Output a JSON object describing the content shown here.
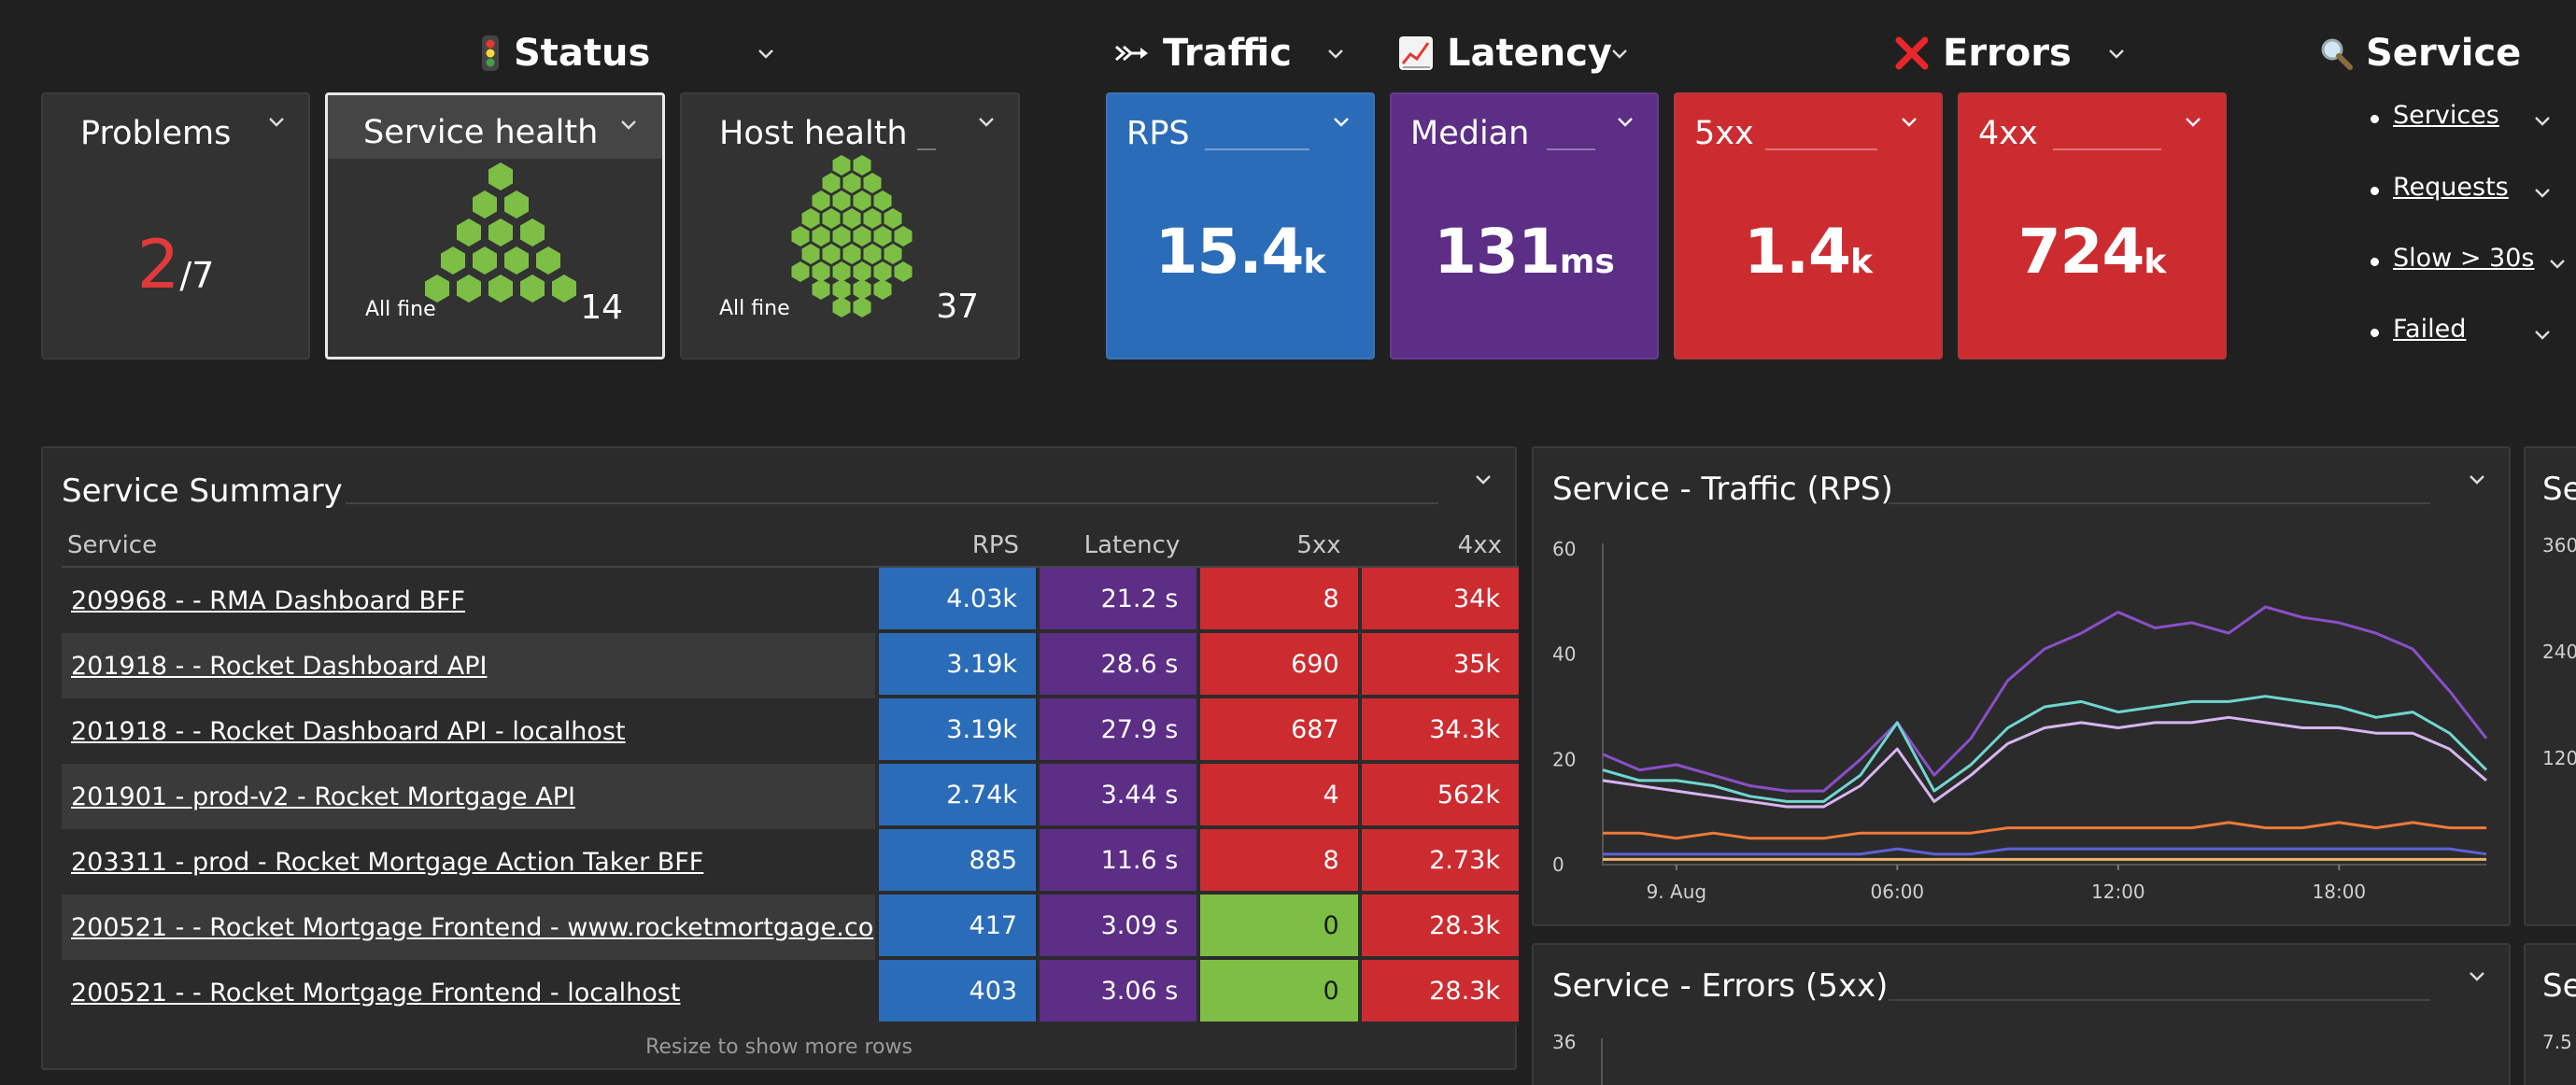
{
  "sections": {
    "status": {
      "label": "Status",
      "icon": "traffic-light-icon"
    },
    "traffic": {
      "label": "Traffic",
      "icon": "arrow-icon"
    },
    "latency": {
      "label": "Latency",
      "icon": "chart-icon"
    },
    "errors": {
      "label": "Errors",
      "icon": "cross-icon"
    },
    "service": {
      "label": "Service",
      "icon": "magnifier-icon"
    }
  },
  "tiles": {
    "problems": {
      "title": "Problems",
      "value": "2",
      "total": "/7"
    },
    "service_health": {
      "title": "Service health",
      "status": "All fine",
      "count": "14",
      "hex_color": "#7dbf44"
    },
    "host_health": {
      "title": "Host health",
      "status": "All fine",
      "count": "37",
      "hex_color": "#7dbf44"
    },
    "rps": {
      "title": "RPS",
      "value": "15.4",
      "unit": "k",
      "color": "#2b6cb8"
    },
    "median": {
      "title": "Median",
      "value": "131",
      "unit": "ms",
      "color": "#5c2e86"
    },
    "err5xx": {
      "title": "5xx",
      "value": "1.4",
      "unit": "k",
      "color": "#cc2c30"
    },
    "err4xx": {
      "title": "4xx",
      "value": "724",
      "unit": "k",
      "color": "#cc2c30"
    }
  },
  "service_links": [
    "Services",
    "Requests",
    "Slow > 30s",
    "Failed"
  ],
  "summary": {
    "title": "Service Summary",
    "columns": [
      "Service",
      "RPS",
      "Latency",
      "5xx",
      "4xx"
    ],
    "rows": [
      {
        "service": "209968 - - RMA Dashboard BFF",
        "rps": "4.03k",
        "latency": "21.2 s",
        "e5xx": "8",
        "e4xx": "34k"
      },
      {
        "service": "201918 - - Rocket Dashboard API",
        "rps": "3.19k",
        "latency": "28.6 s",
        "e5xx": "690",
        "e4xx": "35k"
      },
      {
        "service": "201918 - - Rocket Dashboard API - localhost",
        "rps": "3.19k",
        "latency": "27.9 s",
        "e5xx": "687",
        "e4xx": "34.3k"
      },
      {
        "service": "201901 - prod-v2 - Rocket Mortgage API",
        "rps": "2.74k",
        "latency": "3.44 s",
        "e5xx": "4",
        "e4xx": "562k"
      },
      {
        "service": "203311 - prod - Rocket Mortgage Action Taker BFF",
        "rps": "885",
        "latency": "11.6 s",
        "e5xx": "8",
        "e4xx": "2.73k"
      },
      {
        "service": "200521 - - Rocket Mortgage Frontend - www.rocketmortgage.co",
        "rps": "417",
        "latency": "3.09 s",
        "e5xx": "0",
        "e4xx": "28.3k"
      },
      {
        "service": "200521 - - Rocket Mortgage Frontend - localhost",
        "rps": "403",
        "latency": "3.06 s",
        "e5xx": "0",
        "e4xx": "28.3k"
      }
    ],
    "note": "Resize to show more rows"
  },
  "traffic_panel": {
    "title": "Service - Traffic (RPS)"
  },
  "errors_panel": {
    "title": "Service - Errors (5xx)",
    "first_tick": "36"
  },
  "right_panel": {
    "title": "Se",
    "ticks": [
      "360",
      "240",
      "120"
    ],
    "bottom_title": "Se",
    "bottom_tick": "7.5"
  },
  "colors": {
    "bg": "#202020",
    "tile": "#323232",
    "blue": "#2b6cb8",
    "purple": "#5c2e86",
    "red": "#cc2c30",
    "green": "#7dbf44"
  },
  "chart_data": {
    "type": "line",
    "title": "Service - Traffic (RPS)",
    "xlabel": "",
    "ylabel": "",
    "ylim": [
      0,
      60
    ],
    "yticks": [
      "0",
      "20",
      "40",
      "60"
    ],
    "x_tick_labels": [
      "9. Aug",
      "06:00",
      "12:00",
      "18:00"
    ],
    "x_ticks_pos": [
      2,
      8,
      14,
      20
    ],
    "xlim": [
      0,
      24
    ],
    "grid": false,
    "series": [
      {
        "color": "#8a4fc9",
        "x": [
          0,
          1,
          2,
          3,
          4,
          5,
          6,
          7,
          8,
          9,
          10,
          11,
          12,
          13,
          14,
          15,
          16,
          17,
          18,
          19,
          20,
          21,
          22,
          23,
          24
        ],
        "y": [
          21,
          18,
          19,
          17,
          15,
          14,
          14,
          20,
          27,
          17,
          24,
          35,
          41,
          44,
          48,
          45,
          46,
          44,
          49,
          47,
          46,
          44,
          41,
          33,
          24
        ]
      },
      {
        "color": "#6fd6d0",
        "x": [
          0,
          1,
          2,
          3,
          4,
          5,
          6,
          7,
          8,
          9,
          10,
          11,
          12,
          13,
          14,
          15,
          16,
          17,
          18,
          19,
          20,
          21,
          22,
          23,
          24
        ],
        "y": [
          18,
          16,
          16,
          15,
          13,
          12,
          12,
          17,
          27,
          14,
          19,
          26,
          30,
          31,
          29,
          30,
          31,
          31,
          32,
          31,
          30,
          28,
          29,
          25,
          18
        ]
      },
      {
        "color": "#d7b5f0",
        "x": [
          0,
          1,
          2,
          3,
          4,
          5,
          6,
          7,
          8,
          9,
          10,
          11,
          12,
          13,
          14,
          15,
          16,
          17,
          18,
          19,
          20,
          21,
          22,
          23,
          24
        ],
        "y": [
          16,
          15,
          14,
          13,
          12,
          11,
          11,
          15,
          22,
          12,
          17,
          23,
          26,
          27,
          26,
          27,
          27,
          28,
          27,
          26,
          26,
          25,
          25,
          22,
          16
        ]
      },
      {
        "color": "#ee7a3a",
        "x": [
          0,
          1,
          2,
          3,
          4,
          5,
          6,
          7,
          8,
          9,
          10,
          11,
          12,
          13,
          14,
          15,
          16,
          17,
          18,
          19,
          20,
          21,
          22,
          23,
          24
        ],
        "y": [
          6,
          6,
          5,
          6,
          5,
          5,
          5,
          6,
          6,
          6,
          6,
          7,
          7,
          7,
          7,
          7,
          7,
          8,
          7,
          7,
          8,
          7,
          8,
          7,
          7
        ]
      },
      {
        "color": "#5b63d6",
        "x": [
          0,
          1,
          2,
          3,
          4,
          5,
          6,
          7,
          8,
          9,
          10,
          11,
          12,
          13,
          14,
          15,
          16,
          17,
          18,
          19,
          20,
          21,
          22,
          23,
          24
        ],
        "y": [
          2,
          2,
          2,
          2,
          2,
          2,
          2,
          2,
          3,
          2,
          2,
          3,
          3,
          3,
          3,
          3,
          3,
          3,
          3,
          3,
          3,
          3,
          3,
          3,
          2
        ]
      },
      {
        "color": "#f1b36b",
        "x": [
          0,
          1,
          2,
          3,
          4,
          5,
          6,
          7,
          8,
          9,
          10,
          11,
          12,
          13,
          14,
          15,
          16,
          17,
          18,
          19,
          20,
          21,
          22,
          23,
          24
        ],
        "y": [
          1,
          1,
          1,
          1,
          1,
          1,
          1,
          1,
          1,
          1,
          1,
          1,
          1,
          1,
          1,
          1,
          1,
          1,
          1,
          1,
          1,
          1,
          1,
          1,
          1
        ]
      }
    ]
  }
}
